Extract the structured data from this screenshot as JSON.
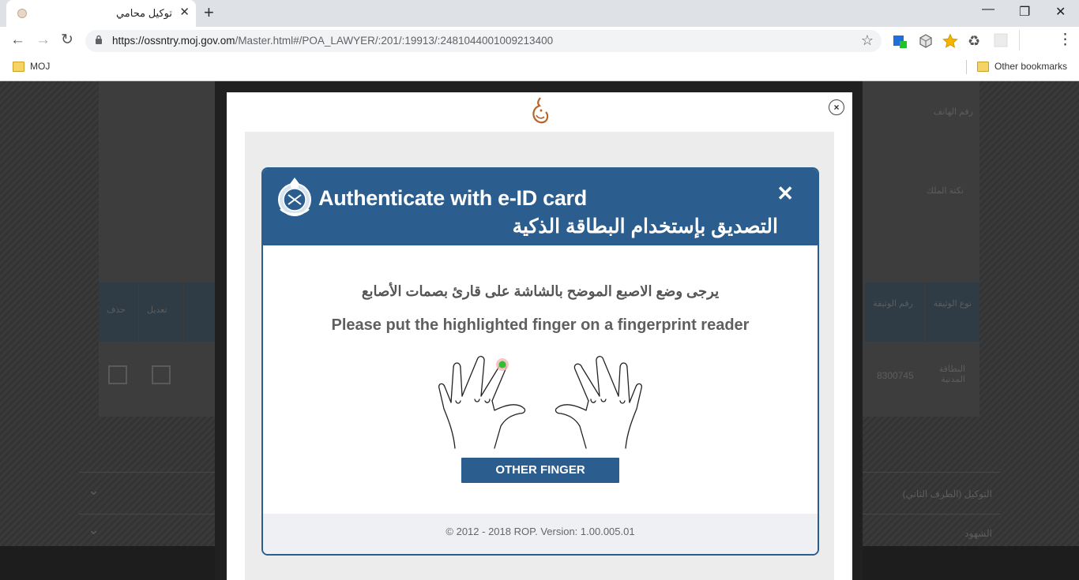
{
  "browser": {
    "tab": {
      "title": "توكيل محامي",
      "close_glyph": "✕"
    },
    "new_tab_glyph": "+",
    "window_controls": {
      "minimize": "—",
      "restore": "❐",
      "close": "✕"
    },
    "nav": {
      "back": "←",
      "forward": "→",
      "reload": "↻"
    },
    "url": {
      "host": "https://ossntry.moj.gov.om",
      "path": "/Master.html#/POA_LAWYER/:201/:19913/:2481044001009213400"
    },
    "bookmarks": [
      {
        "label": "MOJ"
      },
      {
        "label": "Other bookmarks"
      }
    ],
    "extensions": [
      "puzzle-extension-icon",
      "cube-extension-icon",
      "star-extension-icon",
      "recycle-extension-icon",
      "grid-extension-icon"
    ],
    "menu_glyph": "⋮"
  },
  "background_page": {
    "fields": [
      "رقم الهاتف",
      "نكتة الملك"
    ],
    "table_headers": [
      "حذف",
      "تعديل",
      "رقم الوثيقة",
      "نوع الوثيقة"
    ],
    "row_value": "8300745",
    "row_type": "البطاقة المدنية",
    "sections": [
      "التوكيل (الطرف الثاني)",
      "الشهود"
    ]
  },
  "outer_modal": {
    "close_glyph": "×"
  },
  "auth_dialog": {
    "title_en": "Authenticate with e-ID card",
    "title_ar": "التصديق بإستخدام البطاقة الذكية",
    "close_glyph": "✕",
    "instruction_ar": "يرجى وضع الاصبع الموضح بالشاشة على قارئ بصمات الأصابع",
    "instruction_en": "Please put the highlighted finger on a fingerprint reader",
    "highlighted_finger": "left-middle-finger",
    "other_finger_button": "OTHER FINGER",
    "footer": "© 2012 - 2018 ROP. Version: 1.00.005.01"
  },
  "colors": {
    "accent": "#2b5e8e",
    "highlight": "#2fbf2f"
  }
}
